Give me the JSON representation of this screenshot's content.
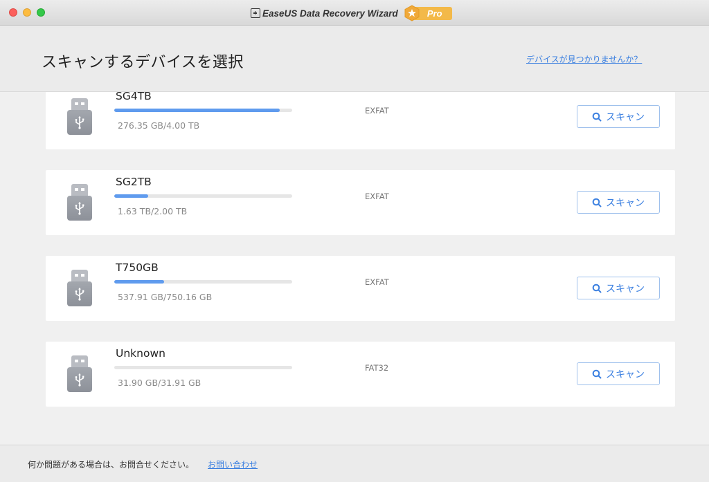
{
  "window": {
    "app_title": "EaseUS Data Recovery Wizard",
    "badge_label": "Pro"
  },
  "header": {
    "title": "スキャンするデバイスを選択",
    "help_link": "デバイスが見つかりませんか？"
  },
  "devices": [
    {
      "name": "SG4TB",
      "size": "276.35 GB/4.00 TB",
      "filesystem": "EXFAT",
      "usage_fraction": 0.93,
      "scan_label": "スキャン"
    },
    {
      "name": "SG2TB",
      "size": "1.63 TB/2.00 TB",
      "filesystem": "EXFAT",
      "usage_fraction": 0.19,
      "scan_label": "スキャン"
    },
    {
      "name": "T750GB",
      "size": "537.91 GB/750.16 GB",
      "filesystem": "EXFAT",
      "usage_fraction": 0.28,
      "scan_label": "スキャン"
    },
    {
      "name": "Unknown",
      "size": "31.90 GB/31.91 GB",
      "filesystem": "FAT32",
      "usage_fraction": 0.0,
      "scan_label": "スキャン"
    }
  ],
  "footer": {
    "text": "何か問題がある場合は、お問合せください。",
    "link": "お問い合わせ"
  },
  "colors": {
    "accent": "#3a7fe0",
    "bar_fill": "#5f9bee",
    "badge": "#f3b949"
  },
  "icons": [
    "usb-drive-icon",
    "search-icon",
    "star-icon",
    "app-logo-icon"
  ]
}
